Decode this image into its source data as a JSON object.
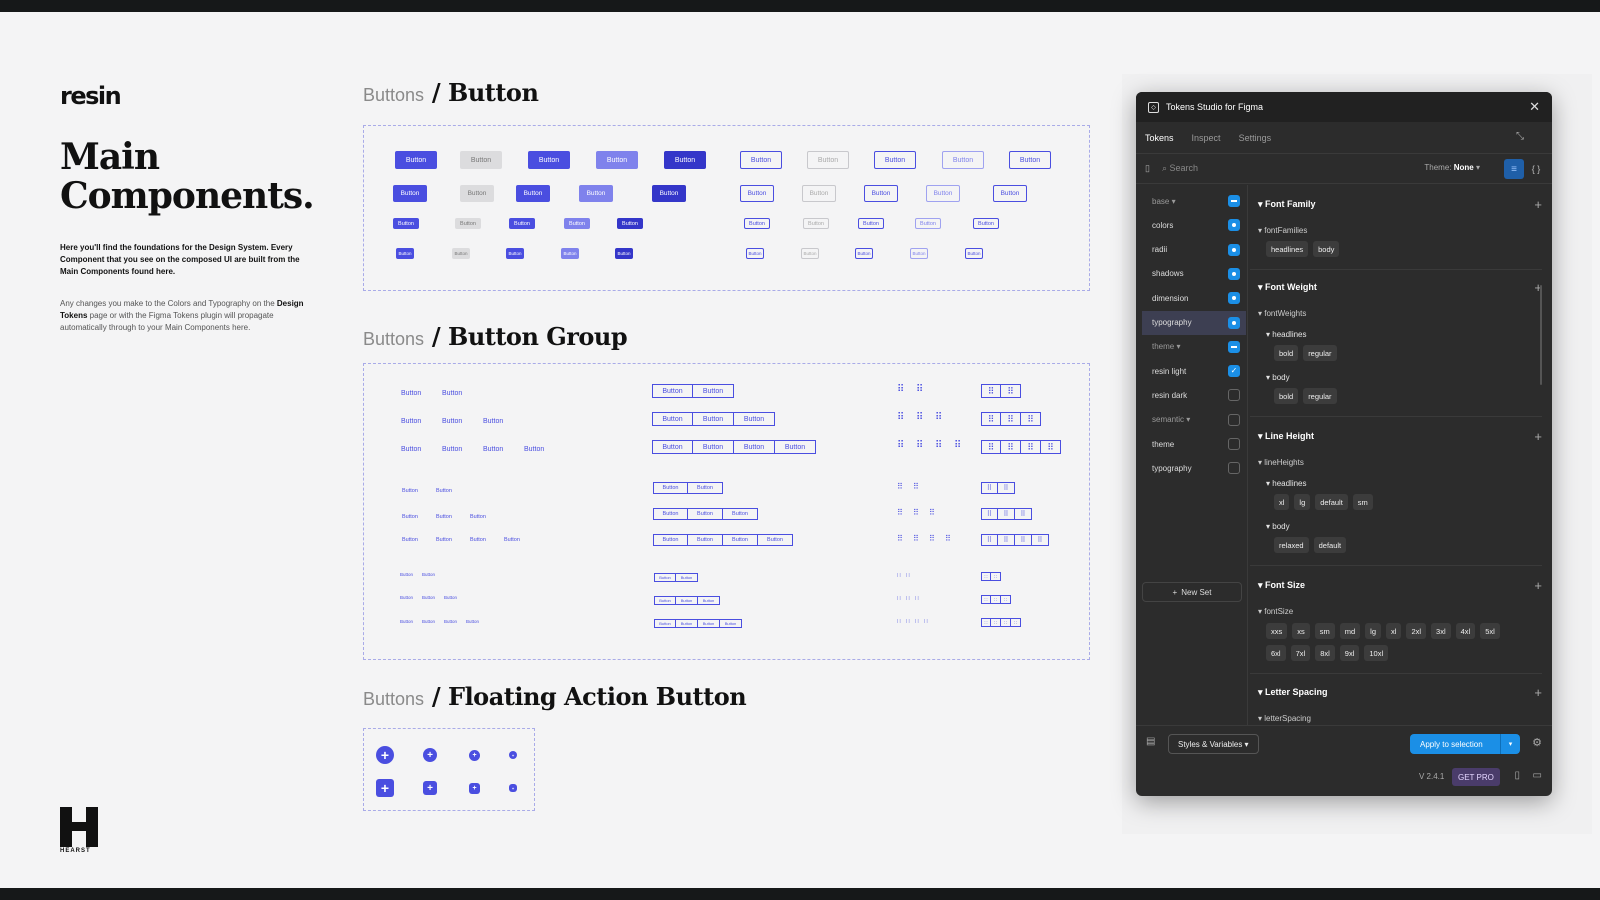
{
  "page": {
    "logo": "resin",
    "title_line1": "Main",
    "title_line2": "Components.",
    "intro": "Here you'll find the foundations for the Design System. Every Component that you see on the composed UI are built from the Main Components found here.",
    "intro2_a": "Any changes you make to the Colors and Typography on the ",
    "intro2_b": "Design Tokens",
    "intro2_c": " page or with the Figma Tokens plugin will propagate automatically through to your Main Components here.",
    "brand": "HEARST"
  },
  "sections": [
    {
      "prefix": "Buttons",
      "title": "/ Button"
    },
    {
      "prefix": "Buttons",
      "title": "/ Button Group"
    },
    {
      "prefix": "Buttons",
      "title": "/ Floating Action Button"
    }
  ],
  "button_label": "Button",
  "plugin": {
    "title": "Tokens Studio for Figma",
    "tabs": [
      "Tokens",
      "Inspect",
      "Settings"
    ],
    "search_placeholder": "Search",
    "theme_label": "Theme:",
    "theme_value": "None",
    "sets": [
      {
        "label": "base",
        "type": "group",
        "state": "ind"
      },
      {
        "label": "colors",
        "type": "item",
        "state": "on"
      },
      {
        "label": "radii",
        "type": "item",
        "state": "on"
      },
      {
        "label": "shadows",
        "type": "item",
        "state": "on"
      },
      {
        "label": "dimension",
        "type": "item",
        "state": "on"
      },
      {
        "label": "typography",
        "type": "item",
        "state": "on",
        "selected": true
      },
      {
        "label": "theme",
        "type": "group",
        "state": "ind"
      },
      {
        "label": "resin light",
        "type": "item",
        "state": "chk"
      },
      {
        "label": "resin dark",
        "type": "item",
        "state": "off"
      },
      {
        "label": "semantic",
        "type": "group",
        "state": "off"
      },
      {
        "label": "theme",
        "type": "item",
        "state": "off"
      },
      {
        "label": "typography",
        "type": "item",
        "state": "off"
      }
    ],
    "new_set": "New Set",
    "groups": {
      "font_family": {
        "title": "Font Family",
        "sub": "fontFamilies",
        "tokens": [
          "headlines",
          "body"
        ]
      },
      "font_weight": {
        "title": "Font Weight",
        "sub": "fontWeights",
        "headlines": "headlines",
        "headlines_tokens": [
          "bold",
          "regular"
        ],
        "body": "body",
        "body_tokens": [
          "bold",
          "regular"
        ]
      },
      "line_height": {
        "title": "Line Height",
        "sub": "lineHeights",
        "headlines": "headlines",
        "headlines_tokens": [
          "xl",
          "lg",
          "default",
          "sm"
        ],
        "body": "body",
        "body_tokens": [
          "relaxed",
          "default"
        ]
      },
      "font_size": {
        "title": "Font Size",
        "sub": "fontSize",
        "row1": [
          "xxs",
          "xs",
          "sm",
          "md",
          "lg",
          "xl",
          "2xl",
          "3xl",
          "4xl",
          "5xl"
        ],
        "row2": [
          "6xl",
          "7xl",
          "8xl",
          "9xl",
          "10xl"
        ]
      },
      "letter_spacing": {
        "title": "Letter Spacing",
        "sub": "letterSpacing"
      }
    },
    "footer": {
      "styles_vars": "Styles & Variables",
      "apply": "Apply to selection",
      "version": "V 2.4.1",
      "pro": "GET PRO"
    }
  }
}
